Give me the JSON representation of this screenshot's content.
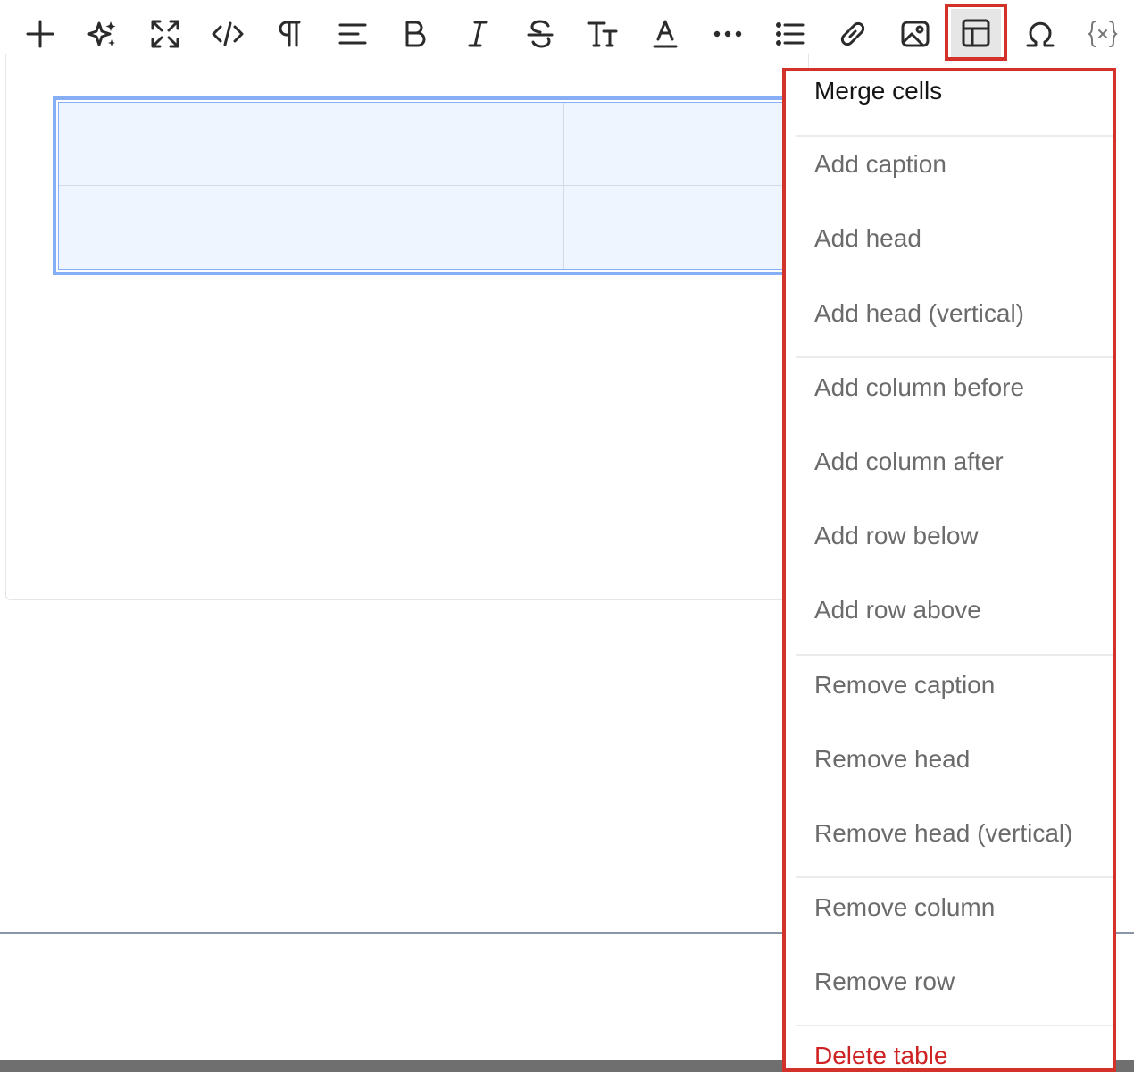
{
  "toolbar": {
    "buttons": [
      {
        "name": "add-icon"
      },
      {
        "name": "ai-sparkle-icon"
      },
      {
        "name": "fullscreen-icon"
      },
      {
        "name": "code-icon"
      },
      {
        "name": "paragraph-icon"
      },
      {
        "name": "align-left-icon"
      },
      {
        "name": "bold-icon"
      },
      {
        "name": "italic-icon"
      },
      {
        "name": "strikethrough-icon"
      },
      {
        "name": "text-size-icon"
      },
      {
        "name": "text-color-icon"
      },
      {
        "name": "more-icon"
      },
      {
        "name": "list-icon"
      },
      {
        "name": "link-icon"
      },
      {
        "name": "image-icon"
      },
      {
        "name": "table-icon"
      },
      {
        "name": "omega-icon"
      },
      {
        "name": "variable-icon"
      }
    ],
    "active": "table-icon",
    "highlight_color": "#d3322a"
  },
  "menu": {
    "items": [
      {
        "label": "Merge cells",
        "kind": "primary"
      },
      {
        "label": "Add caption",
        "kind": "normal"
      },
      {
        "label": "Add head",
        "kind": "normal"
      },
      {
        "label": "Add head (vertical)",
        "kind": "normal"
      },
      {
        "label": "Add column before",
        "kind": "normal"
      },
      {
        "label": "Add column after",
        "kind": "normal"
      },
      {
        "label": "Add row below",
        "kind": "normal"
      },
      {
        "label": "Add row above",
        "kind": "normal"
      },
      {
        "label": "Remove caption",
        "kind": "normal"
      },
      {
        "label": "Remove head",
        "kind": "normal"
      },
      {
        "label": "Remove head (vertical)",
        "kind": "normal"
      },
      {
        "label": "Remove column",
        "kind": "normal"
      },
      {
        "label": "Remove row",
        "kind": "normal"
      },
      {
        "label": "Delete table",
        "kind": "danger"
      }
    ]
  },
  "colors": {
    "accent_red": "#d3322a",
    "table_border": "#86aef5",
    "table_fill": "#eff5ff",
    "danger_text": "#cf2222"
  }
}
